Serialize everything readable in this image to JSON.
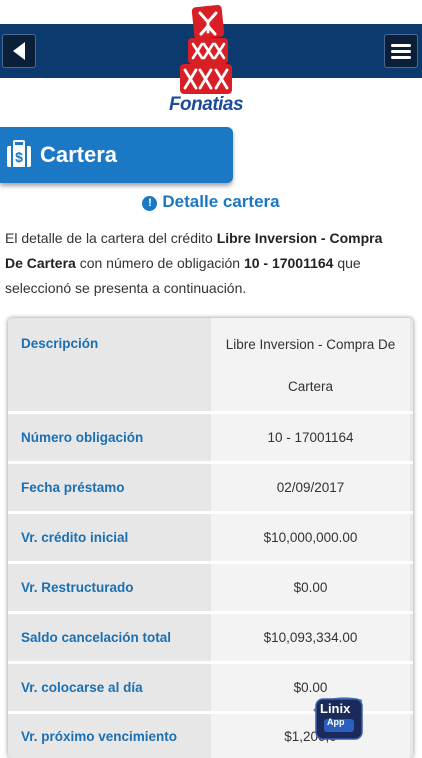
{
  "app": {
    "logo_text": "Fonatias",
    "brand_color": "#0b3a6e",
    "accent_color": "#1b78c4"
  },
  "section": {
    "title": "Cartera",
    "icon": "wallet-icon"
  },
  "detail": {
    "heading": "Detalle cartera",
    "description": {
      "part1": "El detalle de la cartera del crédito ",
      "credit_name": "Libre Inversion - Compra De Cartera",
      "part2": " con número de obligación ",
      "obligation": "10 - 17001164",
      "part3": " que seleccionó se presenta a continuación."
    }
  },
  "table": {
    "rows": [
      {
        "label": "Descripción",
        "value": "Libre Inversion - Compra De Cartera"
      },
      {
        "label": "Número obligación",
        "value": "10 - 17001164"
      },
      {
        "label": "Fecha préstamo",
        "value": "02/09/2017"
      },
      {
        "label": "Vr. crédito inicial",
        "value": "$10,000,000.00"
      },
      {
        "label": "Vr. Restructurado",
        "value": "$0.00"
      },
      {
        "label": "Saldo cancelación total",
        "value": "$10,093,334.00"
      },
      {
        "label": "Vr. colocarse al día",
        "value": "$0.00"
      },
      {
        "label": "Vr. próximo vencimiento",
        "value": "$1,200,0"
      }
    ]
  },
  "badge": {
    "line1": "Linix",
    "line2": "App"
  }
}
